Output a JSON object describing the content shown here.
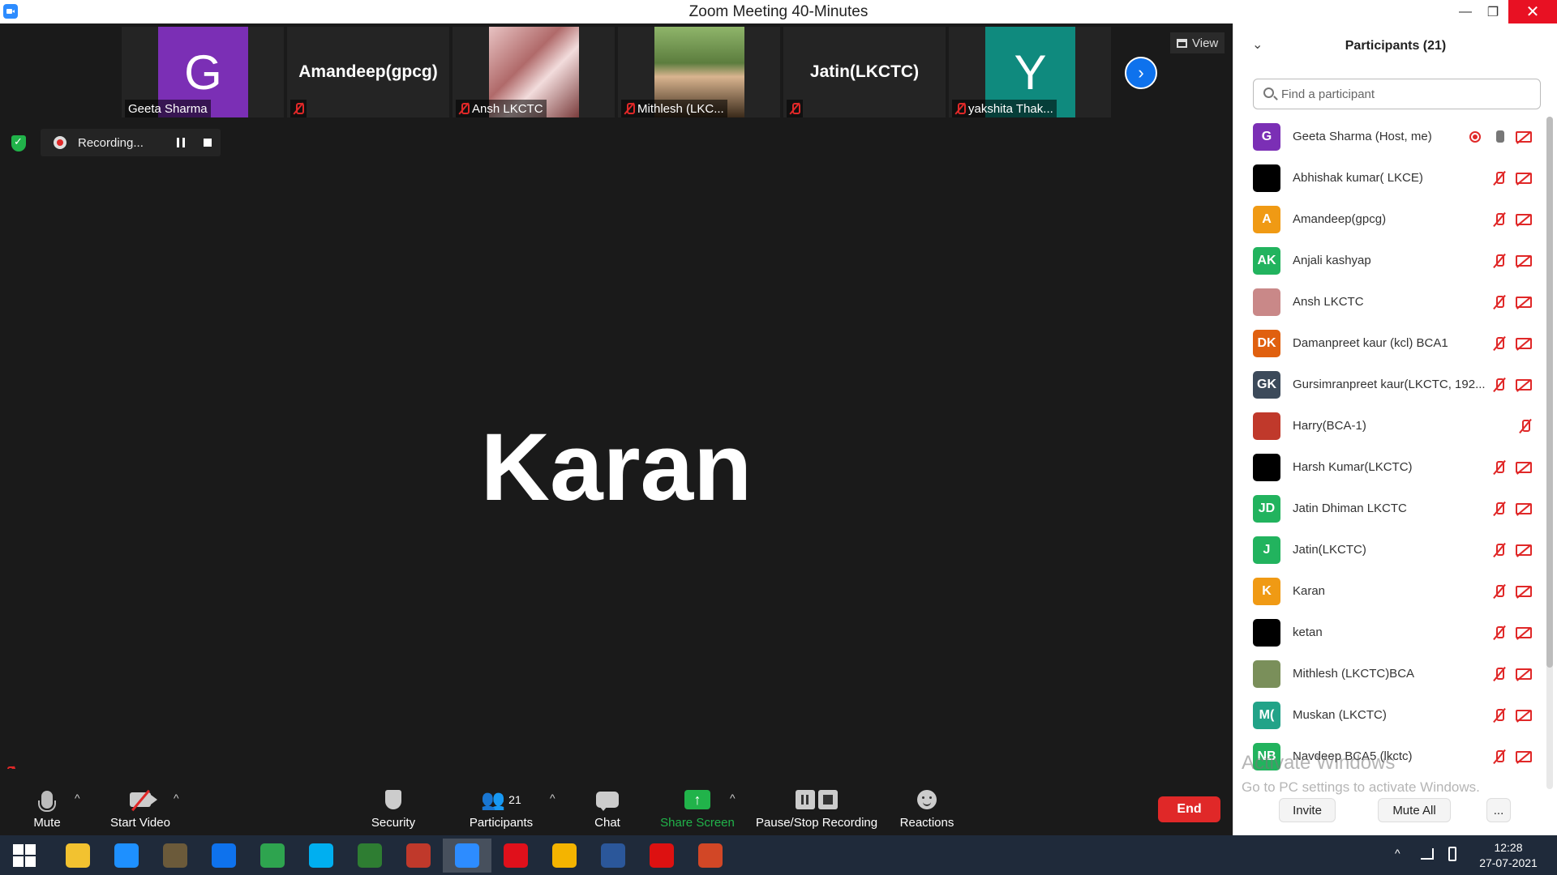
{
  "window": {
    "title": "Zoom Meeting 40-Minutes",
    "minimize": "—",
    "maximize": "❐",
    "close": "✕"
  },
  "thumbnails": [
    {
      "name": "Geeta Sharma",
      "initial": "G",
      "color": "#7b2fb5",
      "muted": false
    },
    {
      "name": "Amandeep(gpcg)",
      "muted": true
    },
    {
      "name": "Ansh LKCTC",
      "muted": true
    },
    {
      "name": "Mithlesh (LKC...",
      "muted": true
    },
    {
      "name": "Jatin(LKCTC)",
      "muted": true
    },
    {
      "name": "yakshita Thak...",
      "initial": "Y",
      "color": "#0f8a7e",
      "muted": true
    }
  ],
  "view_label": "View",
  "next_arrow": "›",
  "recording": {
    "label": "Recording..."
  },
  "active_speaker": "Karan",
  "toolbar": {
    "mute": "Mute",
    "start_video": "Start Video",
    "security": "Security",
    "participants": "Participants",
    "participants_count": "21",
    "chat": "Chat",
    "share_screen": "Share Screen",
    "share_arrow": "↑",
    "pause_stop": "Pause/Stop Recording",
    "reactions": "Reactions",
    "end": "End",
    "caret": "^",
    "people_glyph": "👥",
    "share_color": "#21b34a",
    "end_color": "#e02828"
  },
  "panel": {
    "title": "Participants (21)",
    "collapse": "⌄",
    "search_placeholder": "Find a participant",
    "participants": [
      {
        "name": "Geeta Sharma (Host, me)",
        "initials": "G",
        "color": "#7b2fb5",
        "recording": true,
        "mic": "on"
      },
      {
        "name": "Abhishak kumar( LKCE)",
        "initials": "",
        "color": "#000000",
        "mic": "muted"
      },
      {
        "name": "Amandeep(gpcg)",
        "initials": "A",
        "color": "#f09a14",
        "mic": "muted"
      },
      {
        "name": "Anjali kashyap",
        "initials": "AK",
        "color": "#22b35e",
        "mic": "muted"
      },
      {
        "name": "Ansh LKCTC",
        "initials": "",
        "color": "#c98888",
        "mic": "muted"
      },
      {
        "name": "Damanpreet kaur (kcl) BCA1",
        "initials": "DK",
        "color": "#e0600f",
        "mic": "muted"
      },
      {
        "name": "Gursimranpreet kaur(LKCTC, 192...",
        "initials": "GK",
        "color": "#3c4a5a",
        "mic": "muted"
      },
      {
        "name": "Harry(BCA-1)",
        "initials": "",
        "color": "#c0392b",
        "mic": "muted",
        "no_cam": true
      },
      {
        "name": "Harsh Kumar(LKCTC)",
        "initials": "",
        "color": "#000000",
        "mic": "muted"
      },
      {
        "name": "Jatin Dhiman LKCTC",
        "initials": "JD",
        "color": "#22b35e",
        "mic": "muted"
      },
      {
        "name": "Jatin(LKCTC)",
        "initials": "J",
        "color": "#22b35e",
        "mic": "muted"
      },
      {
        "name": "Karan",
        "initials": "K",
        "color": "#f09a14",
        "mic": "muted"
      },
      {
        "name": "ketan",
        "initials": "",
        "color": "#000000",
        "mic": "muted"
      },
      {
        "name": "Mithlesh (LKCTC)BCA",
        "initials": "",
        "color": "#7a8f5a",
        "mic": "muted"
      },
      {
        "name": "Muskan (LKCTC)",
        "initials": "M(",
        "color": "#22a388",
        "mic": "muted"
      },
      {
        "name": "Navdeep BCA5 (lkctc)",
        "initials": "NB",
        "color": "#22b35e",
        "mic": "muted"
      }
    ],
    "watermark_title": "Activate Windows",
    "watermark_sub": "Go to PC settings to activate Windows.",
    "invite": "Invite",
    "mute_all": "Mute All",
    "more": "..."
  },
  "taskbar": {
    "apps": [
      {
        "name": "file-explorer",
        "color": "#f2c230"
      },
      {
        "name": "internet-explorer",
        "color": "#1e90ff"
      },
      {
        "name": "hikvision",
        "color": "#6b5a3a"
      },
      {
        "name": "teamviewer",
        "color": "#0e72ed"
      },
      {
        "name": "green-app",
        "color": "#2ea44f"
      },
      {
        "name": "skype",
        "color": "#00aff0"
      },
      {
        "name": "camtasia",
        "color": "#2e7d32"
      },
      {
        "name": "ms-office-app",
        "color": "#c0392b"
      },
      {
        "name": "zoom",
        "color": "#2d8cff",
        "active": true
      },
      {
        "name": "opera",
        "color": "#e0101b"
      },
      {
        "name": "chrome",
        "color": "#f4b400"
      },
      {
        "name": "word",
        "color": "#2b579a"
      },
      {
        "name": "acrobat",
        "color": "#d11"
      },
      {
        "name": "powerpoint",
        "color": "#d24726"
      }
    ],
    "time": "12:28",
    "date": "27-07-2021",
    "tray_up": "^"
  }
}
